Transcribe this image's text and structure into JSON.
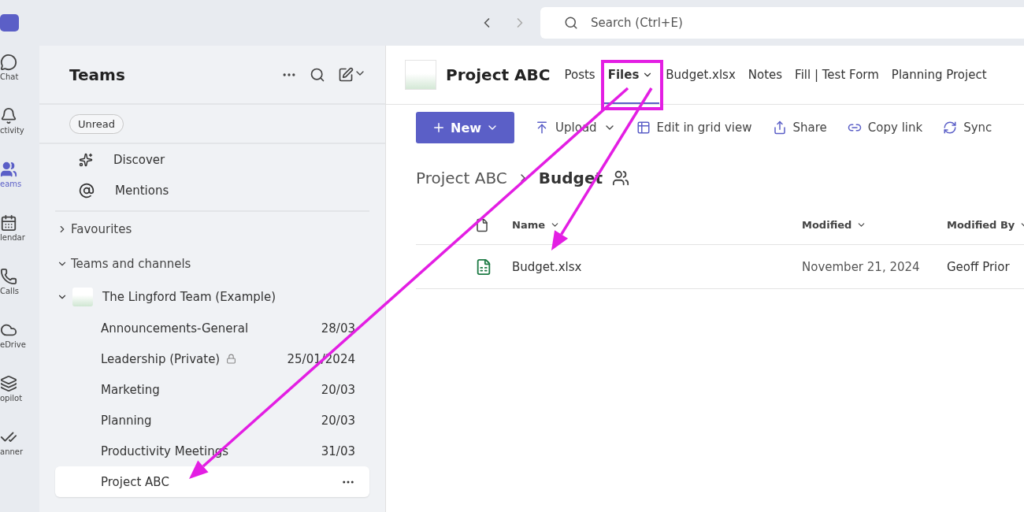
{
  "search": {
    "placeholder": "Search (Ctrl+E)"
  },
  "rail": [
    {
      "label": "Chat",
      "selected": false,
      "kind": "chat"
    },
    {
      "label": "ctivity",
      "selected": false,
      "kind": "activity"
    },
    {
      "label": "eams",
      "selected": true,
      "kind": "teams"
    },
    {
      "label": "lendar",
      "selected": false,
      "kind": "calendar"
    },
    {
      "label": "Calls",
      "selected": false,
      "kind": "calls"
    },
    {
      "label": "eDrive",
      "selected": false,
      "kind": "cloud"
    },
    {
      "label": "opilot",
      "selected": false,
      "kind": "copilot"
    },
    {
      "label": "anner",
      "selected": false,
      "kind": "planner"
    }
  ],
  "sidebar": {
    "title": "Teams",
    "filter": "Unread",
    "links": [
      {
        "label": "Discover",
        "kind": "discover"
      },
      {
        "label": "Mentions",
        "kind": "mentions"
      }
    ],
    "sections": [
      {
        "label": "Favourites",
        "expanded": false
      },
      {
        "label": "Teams and channels",
        "expanded": true
      }
    ],
    "team": {
      "name": "The Lingford Team (Example)",
      "expanded": true,
      "channels": [
        {
          "name": "Announcements-General",
          "date": "28/03",
          "private": false,
          "selected": false
        },
        {
          "name": "Leadership (Private)",
          "date": "25/01/2024",
          "private": true,
          "selected": false
        },
        {
          "name": "Marketing",
          "date": "20/03",
          "private": false,
          "selected": false
        },
        {
          "name": "Planning",
          "date": "20/03",
          "private": false,
          "selected": false
        },
        {
          "name": "Productivity Meetings",
          "date": "31/03",
          "private": false,
          "selected": false
        },
        {
          "name": "Project ABC",
          "private": false,
          "selected": true
        }
      ]
    }
  },
  "channel": {
    "title": "Project ABC",
    "tabs": [
      {
        "label": "Posts",
        "selected": false,
        "dropdown": false
      },
      {
        "label": "Files",
        "selected": true,
        "dropdown": true
      },
      {
        "label": "Budget.xlsx",
        "selected": false,
        "dropdown": false
      },
      {
        "label": "Notes",
        "selected": false,
        "dropdown": false
      },
      {
        "label": "Fill | Test Form",
        "selected": false,
        "dropdown": false
      },
      {
        "label": "Planning Project",
        "selected": false,
        "dropdown": false
      }
    ]
  },
  "toolbar": [
    {
      "label": "New",
      "kind": "new",
      "dropdown": true
    },
    {
      "label": "Upload",
      "kind": "upload",
      "dropdown": true
    },
    {
      "label": "Edit in grid view",
      "kind": "grid",
      "dropdown": false
    },
    {
      "label": "Share",
      "kind": "share",
      "dropdown": false
    },
    {
      "label": "Copy link",
      "kind": "link",
      "dropdown": false
    },
    {
      "label": "Sync",
      "kind": "sync",
      "dropdown": false
    }
  ],
  "breadcrumb": [
    "Project ABC",
    "Budget"
  ],
  "table": {
    "columns": [
      "Name",
      "Modified",
      "Modified By"
    ],
    "rows": [
      {
        "name": "Budget.xlsx",
        "modified": "November 21, 2024",
        "modified_by": "Geoff Prior"
      }
    ]
  },
  "annotations": [
    {
      "kind": "frame"
    },
    {
      "kind": "arrow"
    },
    {
      "kind": "arrow"
    }
  ]
}
